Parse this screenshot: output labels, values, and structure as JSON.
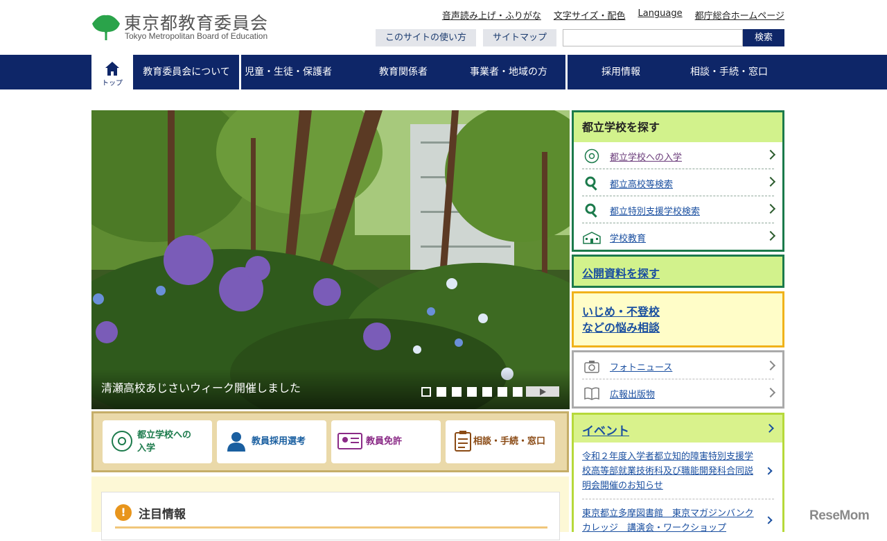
{
  "header": {
    "logo_jp": "東京都教育委員会",
    "logo_en": "Tokyo Metropolitan Board of Education",
    "util_links": [
      "音声読み上げ・ふりがな",
      "文字サイズ・配色",
      "Language",
      "都庁総合ホームページ"
    ],
    "sub_buttons": [
      "このサイトの使い方",
      "サイトマップ"
    ],
    "search_placeholder": "",
    "search_button": "検索"
  },
  "nav": {
    "home_label": "トップ",
    "items": [
      "教育委員会について",
      "児童・生徒・保護者",
      "教育関係者",
      "事業者・地域の方",
      "採用情報",
      "相談・手続・窓口"
    ]
  },
  "hero": {
    "caption": "清瀬高校あじさいウィーク開催しました",
    "slide_count": 8,
    "active_slide": 1
  },
  "quick_links": [
    {
      "label_line1": "都立学校への",
      "label_line2": "入学",
      "icon": "school-flower-icon",
      "color": "#1b7a4b"
    },
    {
      "label_line1": "教員採用選考",
      "label_line2": "",
      "icon": "teacher-icon",
      "color": "#1a5fa0"
    },
    {
      "label_line1": "教員免許",
      "label_line2": "",
      "icon": "license-card-icon",
      "color": "#8a2a86"
    },
    {
      "label_line1": "相談・手続・窓口",
      "label_line2": "",
      "icon": "clipboard-icon",
      "color": "#8a4a14"
    }
  ],
  "attention": {
    "icon_text": "!",
    "title": "注目情報"
  },
  "school_search": {
    "title": "都立学校を探す",
    "items": [
      {
        "label": "都立学校への入学",
        "icon": "school-flower-icon"
      },
      {
        "label": "都立高校等検索",
        "icon": "magnifier-icon"
      },
      {
        "label": "都立特別支援学校検索",
        "icon": "magnifier-icon"
      },
      {
        "label": "学校教育",
        "icon": "school-building-icon"
      }
    ]
  },
  "public_docs": {
    "title": "公開資料を探す"
  },
  "bullying": {
    "line1": "いじめ・不登校",
    "line2": "などの悩み相談"
  },
  "misc": {
    "items": [
      {
        "label": "フォトニュース",
        "icon": "camera-icon"
      },
      {
        "label": "広報出版物",
        "icon": "book-icon"
      }
    ]
  },
  "events": {
    "title": "イベント",
    "items": [
      "令和２年度入学者都立知的障害特別支援学校高等部就業技術科及び職能開発科合同説明会開催のお知らせ",
      "東京都立多摩図書館　東京マガジンバンクカレッジ　講演会・ワークショップ"
    ]
  },
  "watermark": "ReseMom"
}
